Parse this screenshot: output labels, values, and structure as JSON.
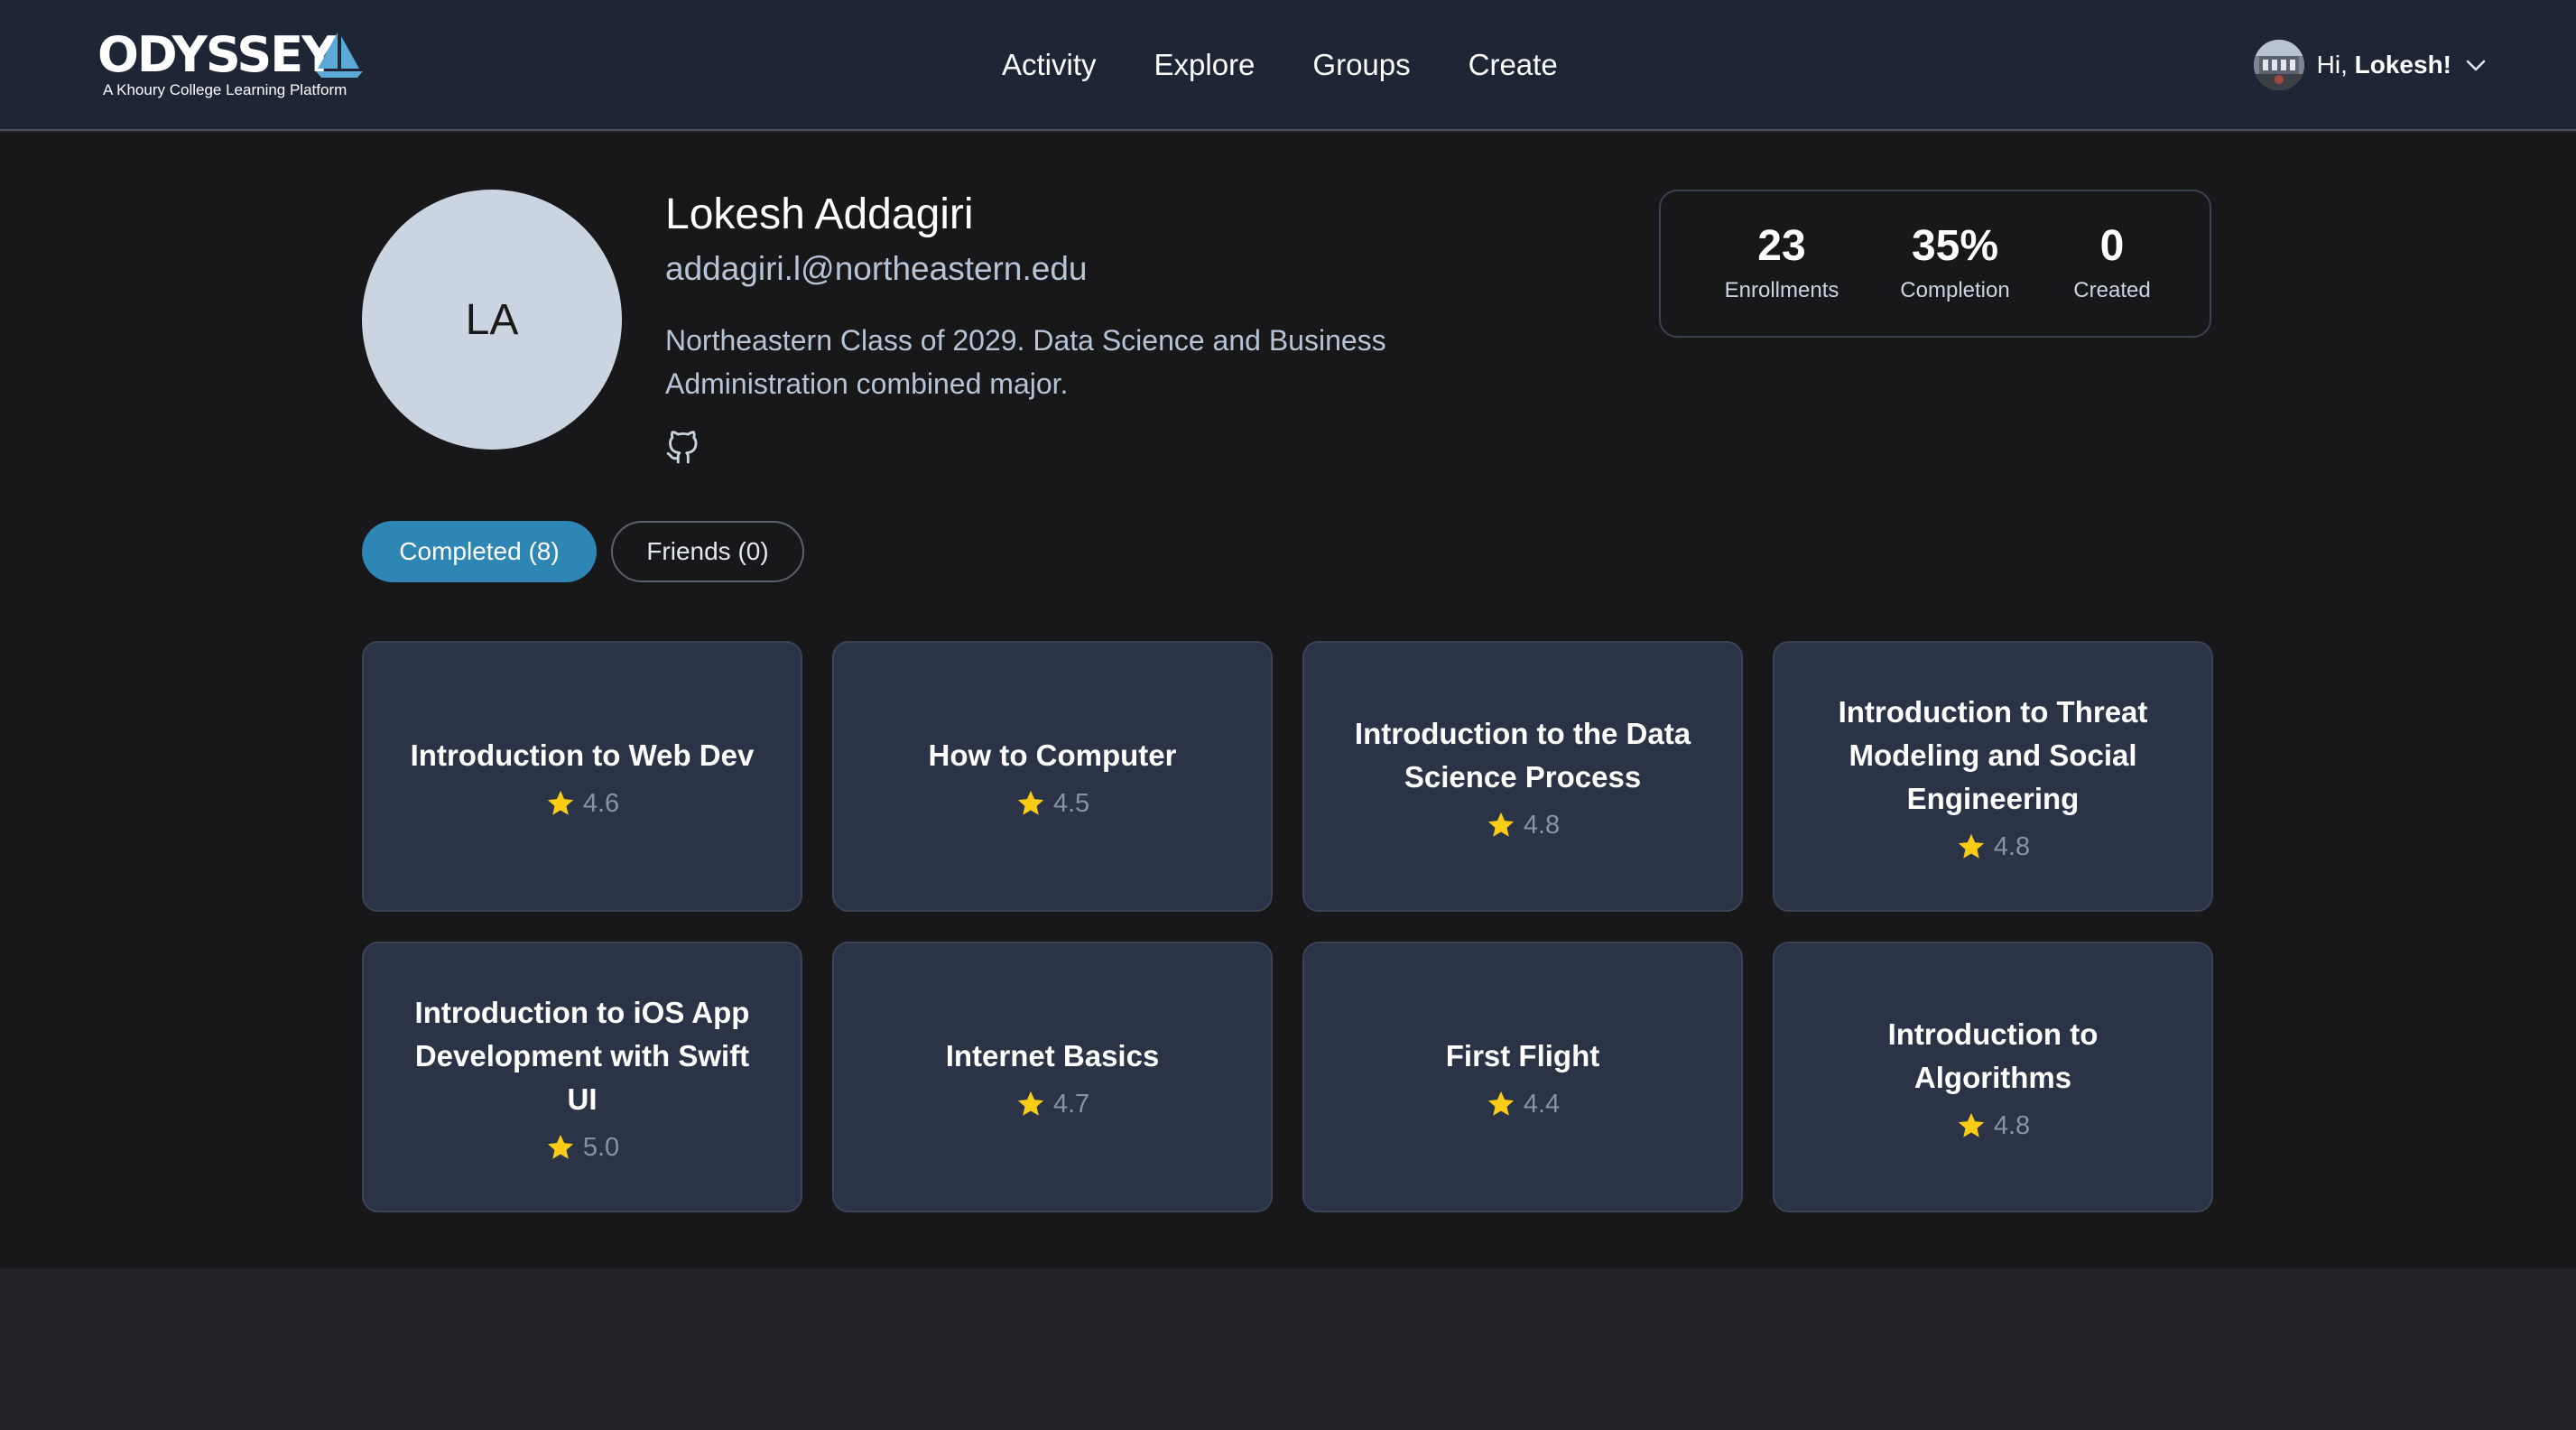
{
  "brand": {
    "name": "ODYSSEY",
    "tagline": "A Khoury College Learning Platform"
  },
  "nav": {
    "links": [
      "Activity",
      "Explore",
      "Groups",
      "Create"
    ]
  },
  "user_menu": {
    "greeting_prefix": "Hi,",
    "user_name": "Lokesh!"
  },
  "profile": {
    "initials": "LA",
    "name": "Lokesh Addagiri",
    "email": "addagiri.l@northeastern.edu",
    "bio": "Northeastern Class of 2029. Data Science and Business Administration combined major."
  },
  "stats": [
    {
      "value": "23",
      "label": "Enrollments"
    },
    {
      "value": "35%",
      "label": "Completion"
    },
    {
      "value": "0",
      "label": "Created"
    }
  ],
  "tabs": {
    "completed": "Completed (8)",
    "friends": "Friends (0)"
  },
  "courses": [
    {
      "title": "Introduction to Web Dev",
      "rating": "4.6"
    },
    {
      "title": "How to Computer",
      "rating": "4.5"
    },
    {
      "title": "Introduction to the Data Science Process",
      "rating": "4.8"
    },
    {
      "title": "Introduction to Threat Modeling and Social Engineering",
      "rating": "4.8"
    },
    {
      "title": "Introduction to iOS App Development with Swift UI",
      "rating": "5.0"
    },
    {
      "title": "Internet Basics",
      "rating": "4.7"
    },
    {
      "title": "First Flight",
      "rating": "4.4"
    },
    {
      "title": "Introduction to Algorithms",
      "rating": "4.8"
    }
  ],
  "colors": {
    "header_bg": "#1e2535",
    "page_bg": "#18181b",
    "card_bg": "#2b3447",
    "accent": "#2e86b5",
    "star": "#facc15",
    "sail": "#5aa9d6"
  },
  "icons": {
    "logo": "sailboat-icon",
    "social": "github-icon",
    "rating": "star-icon",
    "menu": "chevron-down-icon"
  }
}
